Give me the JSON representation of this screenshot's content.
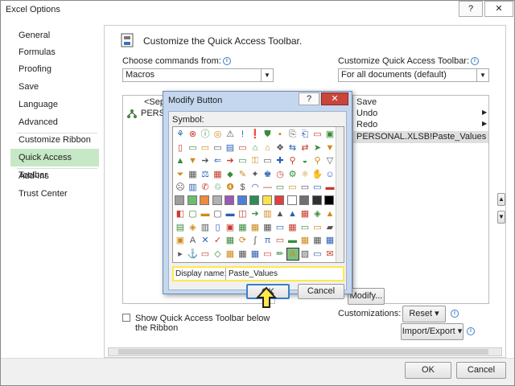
{
  "window": {
    "title": "Excel Options",
    "help_label": "?",
    "close_label": "✕"
  },
  "sidebar": {
    "items": [
      {
        "label": "General"
      },
      {
        "label": "Formulas"
      },
      {
        "label": "Proofing"
      },
      {
        "label": "Save"
      },
      {
        "label": "Language"
      },
      {
        "label": "Advanced"
      },
      {
        "label": "Customize Ribbon"
      },
      {
        "label": "Quick Access Toolbar"
      },
      {
        "label": "Add-Ins"
      },
      {
        "label": "Trust Center"
      }
    ]
  },
  "main": {
    "header": "Customize the Quick Access Toolbar.",
    "choose_label": "Choose commands from:",
    "choose_value": "Macros",
    "customize_label": "Customize Quick Access Toolbar:",
    "customize_value": "For all documents (default)",
    "left_list": [
      "<Separator>",
      "PERSONAL.XLSB!Paste_Values"
    ],
    "right_list": [
      "Save",
      "Undo",
      "Redo",
      "PERSONAL.XLSB!Paste_Values"
    ],
    "modify_label": "Modify...",
    "customizations_label": "Customizations:",
    "reset_label": "Reset ▾",
    "import_export_label": "Import/Export ▾",
    "show_below_label": "Show Quick Access Toolbar below the Ribbon"
  },
  "footer": {
    "ok_label": "OK",
    "cancel_label": "Cancel"
  },
  "dialog": {
    "title": "Modify Button",
    "help_label": "?",
    "close_label": "✕",
    "symbol_label": "Symbol:",
    "display_name_label": "Display name:",
    "display_name_value": "Paste_Values",
    "ok_label": "OK",
    "cancel_label": "Cancel",
    "symbols": [
      [
        "⚘",
        "⊗",
        "ⓘ",
        "◎",
        "⚠",
        "!",
        "❗",
        "⛊",
        "▪",
        "⎘",
        "⎗",
        "▭",
        "▣"
      ],
      [
        "▯",
        "▭",
        "▭",
        "▭",
        "▤",
        "▭",
        "⌂",
        "⌂",
        "❖",
        "⇆",
        "⇄",
        "➤",
        "▼"
      ],
      [
        "▲",
        "▼",
        "➔",
        "⇐",
        "➔",
        "▭",
        "⚿",
        "▭",
        "✚",
        "⚲",
        "◒",
        "⚲",
        "▽"
      ],
      [
        "⏷",
        "▦",
        "⚖",
        "▦",
        "⬥",
        "✎",
        "✦",
        "♚",
        "◷",
        "⚙",
        "⚛",
        "✋",
        "☺"
      ],
      [
        "☹",
        "▥",
        "✆",
        "♲",
        "❹",
        "$",
        "◠",
        "—",
        "▭",
        "▭",
        "▭",
        "▭",
        "▬"
      ],
      [
        "■",
        "■",
        "■",
        "■",
        "■",
        "■",
        "■",
        "■",
        "■",
        "■",
        "■",
        "◩",
        "■"
      ],
      [
        "◧",
        "▢",
        "▬",
        "▢",
        "▬",
        "◫",
        "➔",
        "▥",
        "▲",
        "▲",
        "▦",
        "◈",
        "▲"
      ],
      [
        "▤",
        "◈",
        "▥",
        "▯",
        "▣",
        "▦",
        "▦",
        "▦",
        "▭",
        "▦",
        "▭",
        "▭",
        "▰"
      ],
      [
        "▣",
        "A",
        "✕",
        "✓",
        "▦",
        "⟳",
        "∫",
        "π",
        "▭",
        "▬",
        "▦",
        "▦",
        "▦"
      ],
      [
        "▸",
        "⚓",
        "▭",
        "◇",
        "▦",
        "▦",
        "▦",
        "▭",
        "✏",
        "A",
        "▧",
        "▭",
        "✉"
      ]
    ]
  },
  "colors": {
    "selected_sidebar": "#c6e8c6",
    "dialog_title_bg": "#c4d7ef",
    "highlight": "#ffe94a",
    "swatch_row": [
      "#9e9e9e",
      "#6ebc6e",
      "#f08a3c",
      "#b0b0b0",
      "#9b58b5",
      "#4f7fd8",
      "#2e8b57",
      "#f7e24a",
      "#e04040",
      "#ffffff",
      "#707070",
      "#303030",
      "#000000"
    ]
  }
}
